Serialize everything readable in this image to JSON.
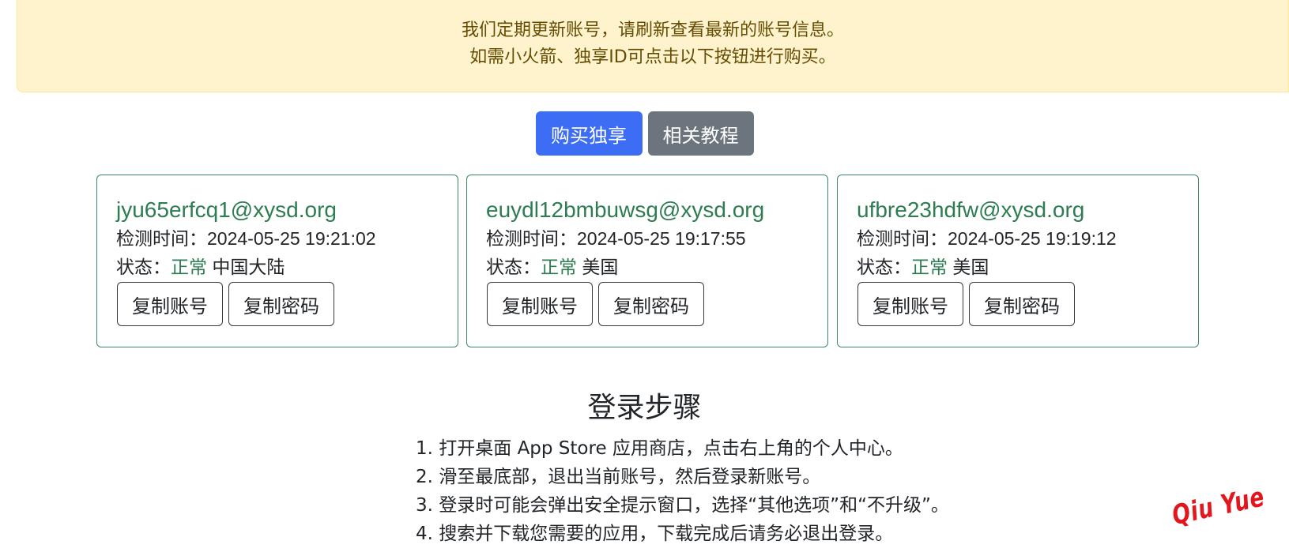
{
  "notice": {
    "line1": "我们定期更新账号，请刷新查看最新的账号信息。",
    "line2": "如需小火箭、独享ID可点击以下按钮进行购买。"
  },
  "actions": {
    "buy_label": "购买独享",
    "tutorial_label": "相关教程"
  },
  "accounts": [
    {
      "email": "jyu65erfcq1@xysd.org",
      "check_label": "检测时间：",
      "check_time": "2024-05-25 19:21:02",
      "status_label": "状态：",
      "status": "正常",
      "region": "中国大陆",
      "copy_account": "复制账号",
      "copy_password": "复制密码"
    },
    {
      "email": "euydl12bmbuwsg@xysd.org",
      "check_label": "检测时间：",
      "check_time": "2024-05-25 19:17:55",
      "status_label": "状态：",
      "status": "正常",
      "region": "美国",
      "copy_account": "复制账号",
      "copy_password": "复制密码"
    },
    {
      "email": "ufbre23hdfw@xysd.org",
      "check_label": "检测时间：",
      "check_time": "2024-05-25 19:19:12",
      "status_label": "状态：",
      "status": "正常",
      "region": "美国",
      "copy_account": "复制账号",
      "copy_password": "复制密码"
    }
  ],
  "login_steps": {
    "title": "登录步骤",
    "steps": [
      "1. 打开桌面 App Store 应用商店，点击右上角的个人中心。",
      "2. 滑至最底部，退出当前账号，然后登录新账号。",
      "3. 登录时可能会弹出安全提示窗口，选择“其他选项”和“不升级”。",
      "4. 搜索并下载您需要的应用，下载完成后请务必退出登录。"
    ]
  },
  "watermark": "Qiu Yue",
  "colors": {
    "notice_bg": "#fff3cd",
    "notice_text": "#664d03",
    "primary": "#3d6df5",
    "secondary": "#6c757d",
    "success": "#2e7d52",
    "watermark": "#e3161d"
  }
}
